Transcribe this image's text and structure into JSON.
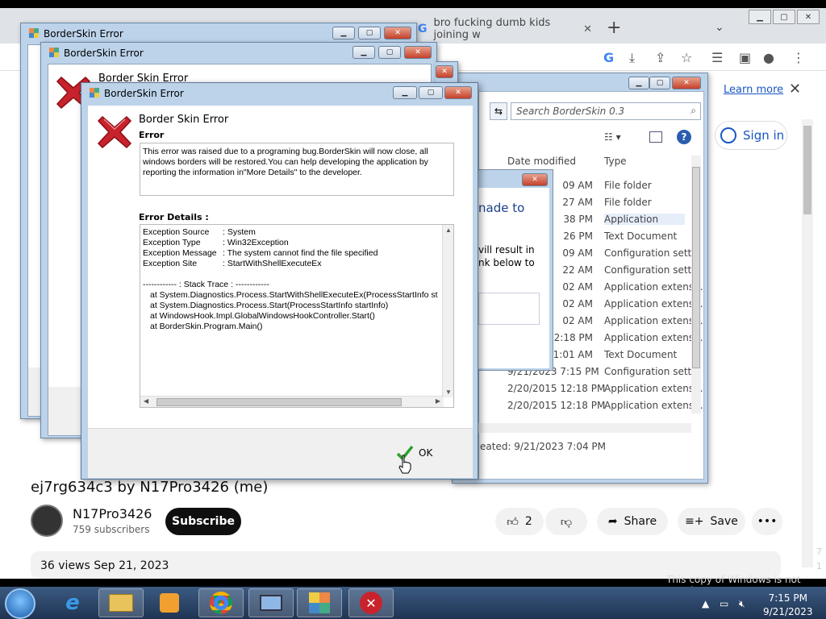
{
  "browser": {
    "tab2_title": "bro fucking dumb kids joining w",
    "learn_more": "Learn more",
    "sign_in": "Sign in"
  },
  "video": {
    "title": "ej7rg634c3 by N17Pro3426 (me)",
    "channel": "N17Pro3426",
    "subscribers": "759 subscribers",
    "subscribe": "Subscribe",
    "likes": "2",
    "share": "Share",
    "save": "Save",
    "views_date": "36 views  Sep 21, 2023"
  },
  "explorer": {
    "search_placeholder": "Search BorderSkin 0.3",
    "col_date": "Date modified",
    "col_type": "Type",
    "rows": [
      {
        "date": "09 AM",
        "type": "File folder"
      },
      {
        "date": "27 AM",
        "type": "File folder"
      },
      {
        "date": "38 PM",
        "type": "Application"
      },
      {
        "date": "26 PM",
        "type": "Text Document"
      },
      {
        "date": "09 AM",
        "type": "Configuration sett..."
      },
      {
        "date": "22 AM",
        "type": "Configuration sett..."
      },
      {
        "date": "02 AM",
        "type": "Application extens..."
      },
      {
        "date": "02 AM",
        "type": "Application extens..."
      },
      {
        "date": "02 AM",
        "type": "Application extens..."
      },
      {
        "date": "2:18 PM",
        "type": "Application extens..."
      },
      {
        "date": "1:01 AM",
        "type": "Text Document"
      },
      {
        "date": "9/21/2023 7:15 PM",
        "type": "Configuration sett..."
      },
      {
        "date": "2/20/2015 12:18 PM",
        "type": "Application extens..."
      },
      {
        "date": "2/20/2015 12:18 PM",
        "type": "Application extens..."
      }
    ],
    "status": "eated:  9/21/2023 7:04 PM"
  },
  "popup": {
    "text1": "nade to",
    "text2": "vill result in",
    "text3": "nk below to"
  },
  "bg_windows": {
    "title1": "BorderSkin Error",
    "title2": "BorderSkin Error",
    "heading_partial": "Border Skin Error"
  },
  "dialog": {
    "title": "BorderSkin Error",
    "heading": "Border Skin Error",
    "error_label": "Error",
    "message_lines": [
      "This error was raised due to a programing bug.BorderSkin will now close, all",
      "windows borders will be restored.You can help developing the application by",
      "reporting the information in\"More Details\" to the developer."
    ],
    "details_label": "Error Details :",
    "details": [
      {
        "k": "Exception Source",
        "v": ": System"
      },
      {
        "k": "Exception Type",
        "v": ": Win32Exception"
      },
      {
        "k": "Exception Message",
        "v": ": The system cannot find the file specified"
      },
      {
        "k": "Exception Site",
        "v": ": StartWithShellExecuteEx"
      }
    ],
    "stack_header": "------------ : Stack Trace : ------------",
    "stack": [
      "at System.Diagnostics.Process.StartWithShellExecuteEx(ProcessStartInfo st",
      "at System.Diagnostics.Process.Start(ProcessStartInfo startInfo)",
      "at WindowsHook.Impl.GlobalWindowsHookController.Start()",
      "at BorderSkin.Program.Main()"
    ],
    "ok": "OK"
  },
  "taskbar": {
    "notice": "This copy of Windows is not genuine",
    "time": "7:15 PM",
    "date": "9/21/2023"
  },
  "colors": {
    "aero_frame": "#bcd3ea",
    "close_red": "#c4412a",
    "error_x": "#c8232c",
    "taskbar": "#2a4468"
  }
}
